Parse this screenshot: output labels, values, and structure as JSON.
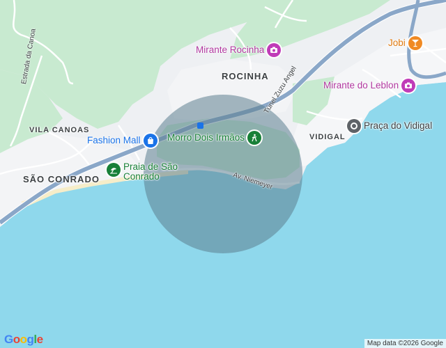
{
  "map": {
    "area_labels": {
      "rocinha": "ROCINHA",
      "vila_canoas": "VILA CANOAS",
      "sao_conrado": "SÃO CONRADO",
      "vidigal": "VIDIGAL"
    },
    "pois": {
      "mirante_rocinha": {
        "name": "Mirante Rocinha",
        "icon": "camera-icon",
        "color": "#c03bb8"
      },
      "jobi": {
        "name": "Jobi",
        "icon": "cocktail-icon",
        "color": "#f08a24"
      },
      "mirante_leblon": {
        "name": "Mirante do Leblon",
        "icon": "camera-icon",
        "color": "#c03bb8"
      },
      "fashion_mall": {
        "name": "Fashion Mall",
        "icon": "shopping-bag-icon",
        "color": "#1a73e8"
      },
      "morro_dois_irmaos": {
        "name": "Morro Dois Irmãos",
        "icon": "hiking-icon",
        "color": "#188038"
      },
      "praca_vidigal": {
        "name": "Praça do Vidigal",
        "icon": "place-icon",
        "color": "#5f6368"
      },
      "praia_sao_conrado_line1": "Praia de São",
      "praia_sao_conrado_line2": "Conrado",
      "praia_sao_conrado_icon": "beach-icon",
      "praia_color": "#188038"
    },
    "streets": {
      "estrada_canoa": "Estrada da Canoa",
      "tunel": "Túnel Zuzu Angel",
      "av_niemeyer": "Av. Niemeyer"
    },
    "colors": {
      "water": "#8fd8ec",
      "land": "#eef0f3",
      "park": "#c8ead0",
      "highway": "#8aa7c8",
      "radius_circle": "#5d7f8f"
    },
    "branding": "Google",
    "attribution": "Map data ©2026 Google"
  }
}
